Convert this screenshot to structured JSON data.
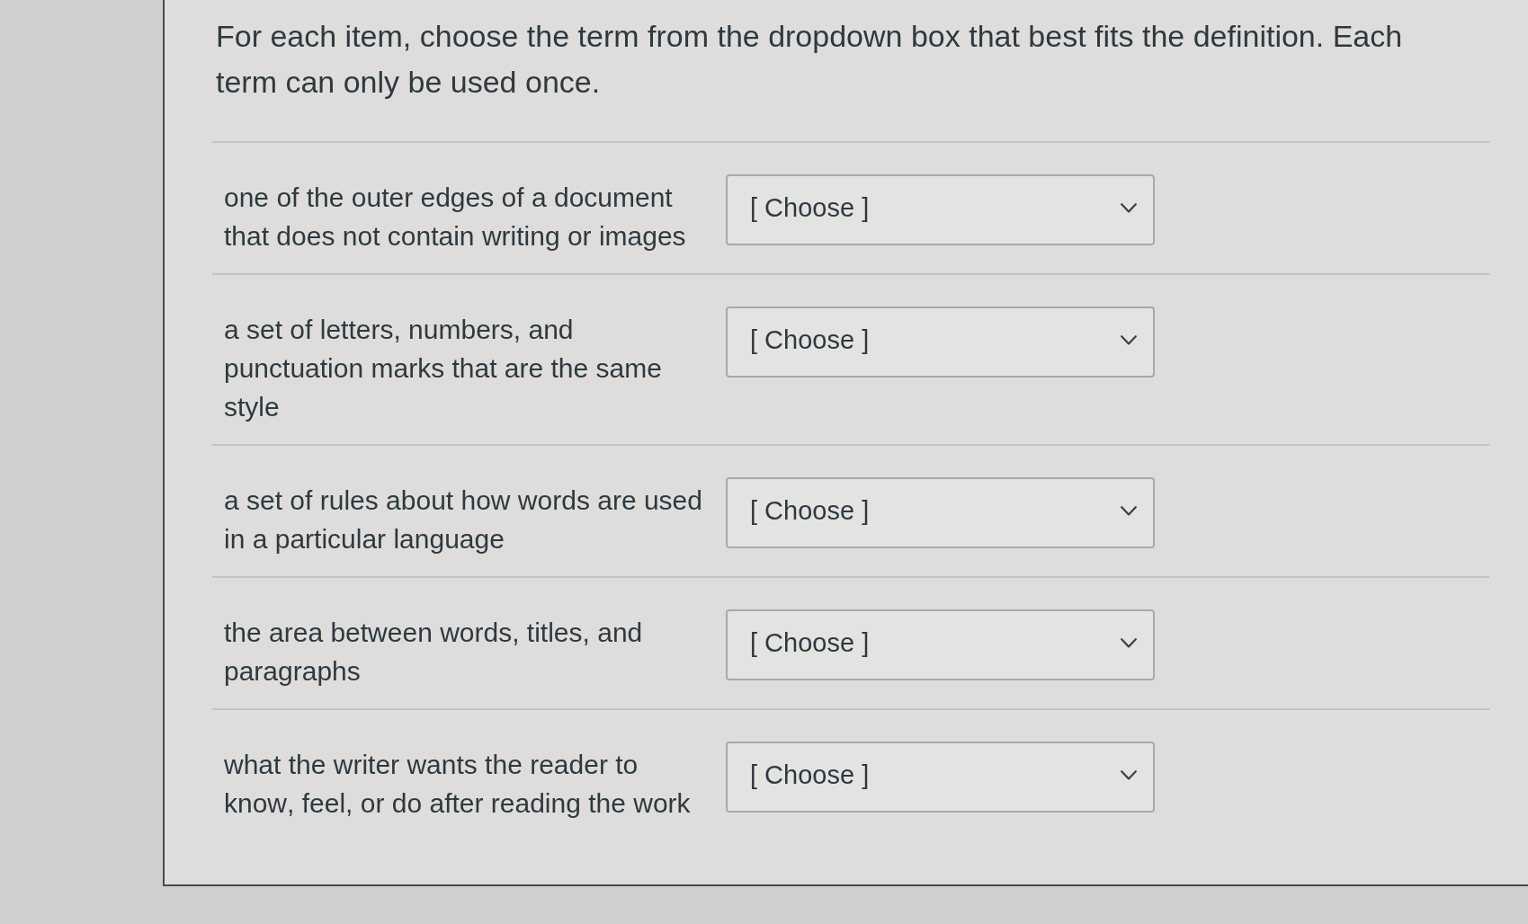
{
  "instructions": "For each item, choose the term from the dropdown box that best fits the definition. Each term can only be used once.",
  "items": [
    {
      "definition": "one of the outer edges of a document that does not contain writing or images",
      "dropdown": {
        "value": "[ Choose ]"
      }
    },
    {
      "definition": "a set of letters, numbers, and punctuation marks that are the same style",
      "dropdown": {
        "value": "[ Choose ]"
      }
    },
    {
      "definition": "a set of rules about how words are used in a particular language",
      "dropdown": {
        "value": "[ Choose ]"
      }
    },
    {
      "definition": "the area between words, titles, and paragraphs",
      "dropdown": {
        "value": "[ Choose ]"
      }
    },
    {
      "definition": "what the writer wants the reader to know, feel, or do after reading the work",
      "dropdown": {
        "value": "[ Choose ]"
      }
    }
  ]
}
